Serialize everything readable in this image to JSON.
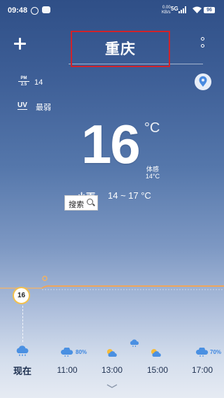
{
  "status_bar": {
    "time": "09:48",
    "network_rate_top": "0.00",
    "network_rate_bottom": "KB/s",
    "hd_label": "5G",
    "battery": "96"
  },
  "header": {
    "city": "重庆"
  },
  "air": {
    "pm_label_top": "PM",
    "pm_label_bottom": "2.5",
    "pm_value": "14",
    "uv_label": "UV",
    "uv_value": "最弱"
  },
  "current": {
    "temperature": "16",
    "unit": "°C",
    "feels_label": "体感",
    "feels_value": "14°C",
    "condition": "小雨",
    "range": "14 ~ 17 °C"
  },
  "search_chip": {
    "label": "搜索"
  },
  "hourly": {
    "now_temp": "16",
    "items": [
      {
        "time": "现在",
        "precip": ""
      },
      {
        "time": "11:00",
        "precip": "80%"
      },
      {
        "time": "13:00",
        "precip": ""
      },
      {
        "time": "15:00",
        "precip": ""
      },
      {
        "time": "17:00",
        "precip": "70%"
      }
    ]
  },
  "colors": {
    "accent_red_box": "#d0232a",
    "temp_line": "#f0a55a",
    "precip_blue": "#3d86e0"
  }
}
